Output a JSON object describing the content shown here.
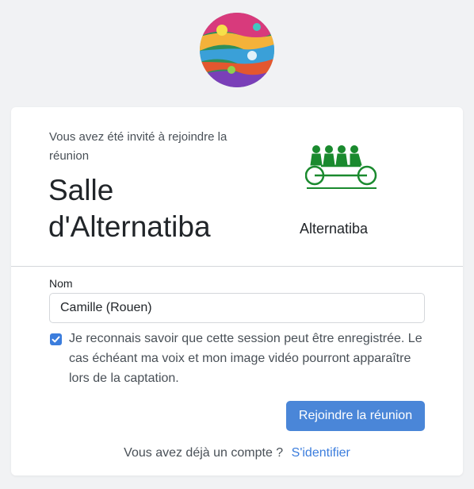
{
  "logo": {
    "icon": "colorful-globe-icon"
  },
  "invite": {
    "text": "Vous avez été invité à rejoindre la réunion",
    "room_title": "Salle d'Alternatiba",
    "org_name": "Alternatiba",
    "org_logo_icon": "tandem-bicycle-icon",
    "org_color": "#1a8a2e"
  },
  "form": {
    "name_label": "Nom",
    "name_value": "Camille (Rouen)",
    "consent_checked": true,
    "consent_text": "Je reconnais savoir que cette session peut être enregistrée. Le cas échéant ma voix et mon image vidéo pourront apparaître lors de la captation.",
    "join_label": "Rejoindre la réunion"
  },
  "account": {
    "prompt": "Vous avez déjà un compte ?",
    "login_link": "S'identifier"
  },
  "colors": {
    "accent": "#4a86d8",
    "background": "#f1f2f4"
  }
}
